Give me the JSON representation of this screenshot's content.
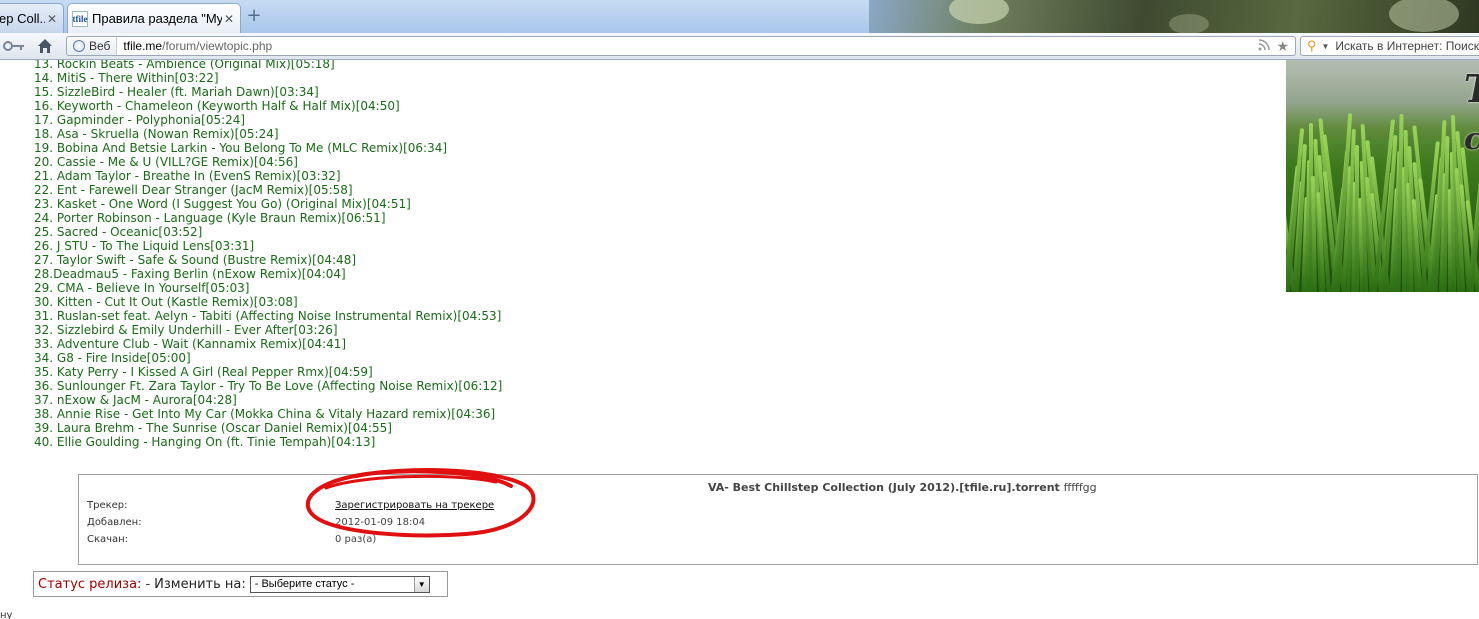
{
  "browser": {
    "tabs": [
      {
        "label": "ep Coll..."
      },
      {
        "favicon": "tfile",
        "label": "Правила раздела \"My..."
      }
    ],
    "address": {
      "web_label": "Веб",
      "host": "tfile.me",
      "path": "/forum/viewtopic.php"
    },
    "search_placeholder": "Искать в Интернет: Поиск"
  },
  "tracks": [
    "13. Rockin Beats - Ambience (Original Mix)[05:18]",
    "14. MitiS - There Within[03:22]",
    "15. SizzleBird - Healer (ft. Mariah Dawn)[03:34]",
    "16. Keyworth - Chameleon (Keyworth Half & Half Mix)[04:50]",
    "17. Gapminder - Polyphonia[05:24]",
    "18. Asa - Skruella (Nowan Remix)[05:24]",
    "19. Bobina And Betsie Larkin - You Belong To Me (MLC Remix)[06:34]",
    "20. Cassie - Me & U (VILL?GE Remix)[04:56]",
    "21. Adam Taylor - Breathe In (EvenS Remix)[03:32]",
    "22. Ent - Farewell Dear Stranger (JacM Remix)[05:58]",
    "23. Kasket - One Word (I Suggest You Go) (Original Mix)[04:51]",
    "24. Porter Robinson - Language (Kyle Braun Remix)[06:51]",
    "25. Sacred - Oceanic[03:52]",
    "26. J STU - To The Liquid Lens[03:31]",
    "27. Taylor Swift - Safe & Sound (Bustre Remix)[04:48]",
    "28.Deadmau5 - Faxing Berlin (nExow Remix)[04:04]",
    "29. CMA - Believe In Yourself[05:03]",
    "30. Kitten - Cut It Out (Kastle Remix)[03:08]",
    "31. Ruslan-set feat. Aelyn - Tabiti (Affecting Noise Instrumental Remix)[04:53]",
    "32. Sizzlebird & Emily Underhill - Ever After[03:26]",
    "33. Adventure Club - Wait (Kannamix Remix)[04:41]",
    "34. G8 - Fire Inside[05:00]",
    "35. Katy Perry - I Kissed A Girl (Real Pepper Rmx)[04:59]",
    "36. Sunlounger Ft. Zara Taylor - Try To Be Love (Affecting Noise Remix)[06:12]",
    "37. nExow & JacM - Aurora[04:28]",
    "38. Annie Rise - Get Into My Car (Mokka China & Vitaly Hazard remix)[04:36]",
    "39. Laura Brehm - The Sunrise (Oscar Daniel Remix)[04:55]",
    "40. Ellie Goulding - Hanging On (ft. Tinie Tempah)[04:13]"
  ],
  "torrent": {
    "title": "VA- Best Chillstep Collection (July 2012).[tfile.ru].torrent",
    "title_suffix": "fffffgg",
    "tracker_label": "Трекер:",
    "tracker_link": "Зарегистрировать на трекере",
    "added_label": "Добавлен:",
    "added_value": "2012-01-09 18:04",
    "downloaded_label": "Скачан:",
    "downloaded_value": "0 раз(а)"
  },
  "release_status": {
    "label": "Статус релиза:",
    "separator": "-",
    "change_label": "Изменить на:",
    "select_value": "- Выберите статус -"
  },
  "footer_fragment": "ну",
  "colors": {
    "track_text": "#1a6b18",
    "status_label": "#a00000",
    "annotation": "#e01010"
  }
}
